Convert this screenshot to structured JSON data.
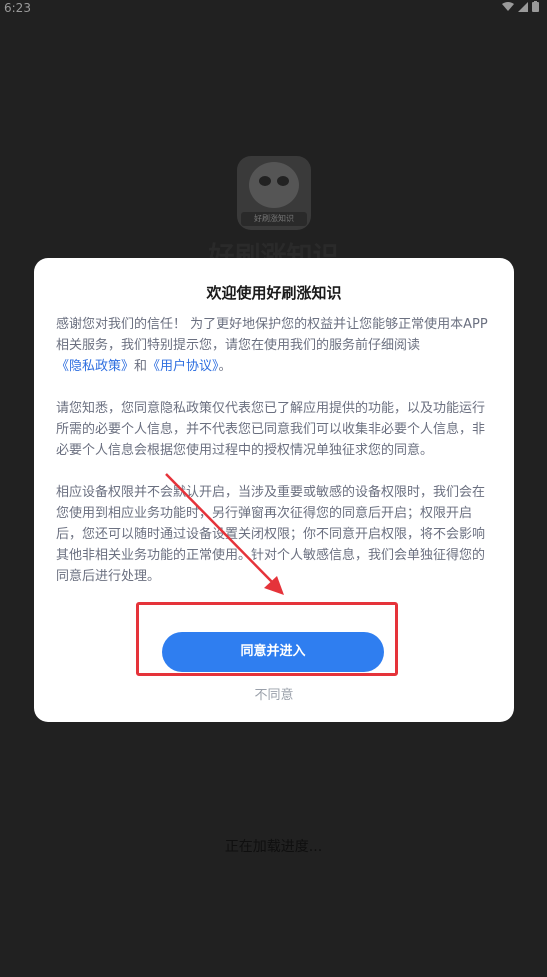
{
  "status_bar": {
    "time": "6:23"
  },
  "splash": {
    "app_name": "好刷涨知识",
    "logo_text": "好刷涨知识",
    "loading_text": "正在加载进度..."
  },
  "dialog": {
    "title": "欢迎使用好刷涨知识",
    "paragraph1_start": "感谢您对我们的信任！ 为了更好地保护您的权益并让您能够正常使用本APP相关服务，我们特别提示您，请您在使用我们的服务前仔细阅读",
    "privacy_link": "《隐私政策》",
    "and_text": "和",
    "user_agreement_link": "《用户协议》",
    "paragraph1_end": "。",
    "paragraph2": "请您知悉，您同意隐私政策仅代表您已了解应用提供的功能，以及功能运行所需的必要个人信息，并不代表您已同意我们可以收集非必要个人信息，非必要个人信息会根据您使用过程中的授权情况单独征求您的同意。",
    "paragraph3": "相应设备权限并不会默认开启，当涉及重要或敏感的设备权限时，我们会在您使用到相应业务功能时，另行弹窗再次征得您的同意后开启；权限开启后，您还可以随时通过设备设置关闭权限；你不同意开启权限，将不会影响其他非相关业务功能的正常使用。针对个人敏感信息，我们会单独征得您的同意后进行处理。",
    "agree_label": "同意并进入",
    "disagree_label": "不同意"
  },
  "colors": {
    "accent": "#2f7ef0",
    "link": "#2f6fe0",
    "annotation": "#e5333a"
  }
}
